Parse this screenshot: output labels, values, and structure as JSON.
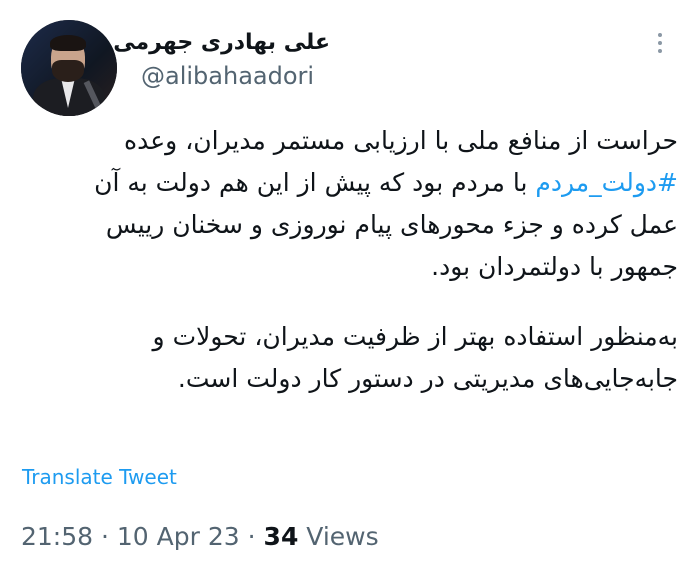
{
  "author": {
    "display_name": "علی بهادری جهرمی",
    "handle": "@alibahaadori",
    "avatar": "profile-photo"
  },
  "menu": {
    "icon": "more-vertical-icon"
  },
  "tweet": {
    "lines": [
      {
        "text": "حراست از منافع ملی با ارزیابی مستمر مدیران، وعده"
      },
      {
        "hashtag": "#دولت_مردم",
        "text": " با مردم بود که پیش از این هم دولت به آن"
      },
      {
        "text": "عمل کرده و جزء محورهای پیام نوروزی و سخنان رییس"
      },
      {
        "text": "جمهور با دولتمردان بود."
      },
      {
        "text": "به‌منظور استفاده بهتر از ظرفیت مدیران، تحولات و"
      },
      {
        "text": "جابه‌جایی‌های مدیریتی در دستور کار دولت است."
      }
    ]
  },
  "translate_label": "Translate Tweet",
  "meta": {
    "time": "21:58",
    "separator": "·",
    "date": "10 Apr 23",
    "views_count": "34",
    "views_label": "Views"
  },
  "colors": {
    "accent": "#1d9bf0",
    "text": "#0f1419",
    "secondary": "#536471"
  }
}
